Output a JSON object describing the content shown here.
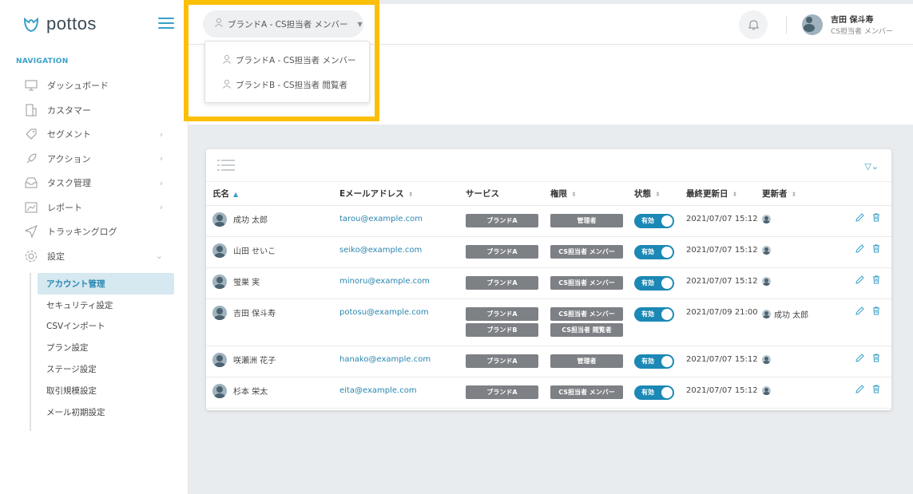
{
  "app": {
    "logo": "pottos"
  },
  "sidebar": {
    "nav_title": "NAVIGATION",
    "items": [
      {
        "label": "ダッシュボード",
        "icon": "monitor-icon",
        "chevron": false
      },
      {
        "label": "カスタマー",
        "icon": "building-icon",
        "chevron": false
      },
      {
        "label": "セグメント",
        "icon": "tag-icon",
        "chevron": true
      },
      {
        "label": "アクション",
        "icon": "rocket-icon",
        "chevron": true
      },
      {
        "label": "タスク管理",
        "icon": "inbox-icon",
        "chevron": true
      },
      {
        "label": "レポート",
        "icon": "chart-icon",
        "chevron": true
      },
      {
        "label": "トラッキングログ",
        "icon": "send-icon",
        "chevron": false
      },
      {
        "label": "設定",
        "icon": "gear-icon",
        "chevron": true
      }
    ],
    "sub_items": [
      "アカウント管理",
      "セキュリティ設定",
      "CSVインポート",
      "プラン設定",
      "ステージ設定",
      "取引規模設定",
      "メール初期設定"
    ]
  },
  "header": {
    "brand_selector": "ブランドA - CS担当者 メンバー",
    "user_name": "吉田 保斗寿",
    "user_role": "CS担当者 メンバー"
  },
  "dropdown": {
    "options": [
      "ブランドA - CS担当者 メンバー",
      "ブランドB - CS担当者 閲覧者"
    ]
  },
  "table": {
    "columns": [
      "氏名",
      "Eメールアドレス",
      "サービス",
      "権限",
      "状態",
      "最終更新日",
      "更新者"
    ],
    "rows": [
      {
        "name": "成功 太郎",
        "email": "tarou@example.com",
        "services": [
          "ブランドA"
        ],
        "perms": [
          "管理者"
        ],
        "status": "有効",
        "updated": "2021/07/07 15:12",
        "updater": ""
      },
      {
        "name": "山田 せいこ",
        "email": "seiko@example.com",
        "services": [
          "ブランドA"
        ],
        "perms": [
          "CS担当者 メンバー"
        ],
        "status": "有効",
        "updated": "2021/07/07 15:12",
        "updater": ""
      },
      {
        "name": "蛍巣 実",
        "email": "minoru@example.com",
        "services": [
          "ブランドA"
        ],
        "perms": [
          "CS担当者 メンバー"
        ],
        "status": "有効",
        "updated": "2021/07/07 15:12",
        "updater": ""
      },
      {
        "name": "吉田 保斗寿",
        "email": "potosu@example.com",
        "services": [
          "ブランドA",
          "ブランドB"
        ],
        "perms": [
          "CS担当者 メンバー",
          "CS担当者 閲覧者"
        ],
        "status": "有効",
        "updated": "2021/07/09 21:00",
        "updater": "成功 太郎"
      },
      {
        "name": "咲瀬洲 花子",
        "email": "hanako@example.com",
        "services": [
          "ブランドA"
        ],
        "perms": [
          "管理者"
        ],
        "status": "有効",
        "updated": "2021/07/07 15:12",
        "updater": ""
      },
      {
        "name": "杉本 栄太",
        "email": "eita@example.com",
        "services": [
          "ブランドA"
        ],
        "perms": [
          "CS担当者 メンバー"
        ],
        "status": "有効",
        "updated": "2021/07/07 15:12",
        "updater": ""
      }
    ]
  },
  "colors": {
    "accent": "#3aa0c8",
    "toggle": "#1b88b5",
    "tag": "#7d8084",
    "highlight": "#fbbf08"
  }
}
